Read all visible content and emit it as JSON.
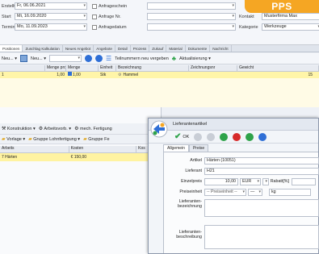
{
  "badge": "PPS",
  "form": {
    "rows": [
      {
        "label": "Erstellt",
        "value": "Fr, 06.06.2021",
        "label2": "Anfrageschein",
        "value2": ""
      },
      {
        "label": "Start",
        "value": "Mi, 16.09.2020",
        "label2": "Anfrage Nr.",
        "value2": "",
        "label3": "Kontakt",
        "value3": "Musterfirma Max"
      },
      {
        "label": "Termin",
        "value": "Mo, 11.09.2023",
        "label2": "Anfragedatum",
        "value2": "",
        "label3": "Kategorie",
        "value3": "Werkzeuge"
      }
    ]
  },
  "tabs": [
    "Positionen",
    "Zuschlag Kalkulation",
    "Neues Angebot",
    "Angebote",
    "Detail",
    "Prozess",
    "Zukauf",
    "Material",
    "Dokumente",
    "Nachricht"
  ],
  "toolbar": {
    "menu_label": "Neu...",
    "item1": "Neu...",
    "action1": "Teilnummern neu vergeben",
    "action2": "Aktualisierung"
  },
  "table1": {
    "headers": [
      "",
      "Menge pro",
      "Menge",
      "Einheit",
      "Bezeichnung",
      "Zeichnungsnr",
      "Gewicht"
    ],
    "rows": [
      [
        "1",
        "1,00",
        "1,00",
        "Stk",
        "Hammel",
        "",
        "15"
      ]
    ]
  },
  "lower": {
    "bar1": [
      "Konstruktion",
      "Arbeitsvorb.",
      "mech. Fertigung"
    ],
    "bar2": [
      "Vorlage",
      "Gruppe Lohnfertigung",
      "Gruppe Fe"
    ],
    "headers": [
      "Arbeits",
      "Kosten",
      "Kos"
    ],
    "rows": [
      [
        "7 Härten",
        "€ 150,00",
        ""
      ]
    ]
  },
  "dialog": {
    "title": "Lieferantenartikel",
    "ok": "OK",
    "tabs": [
      "Allgemein",
      "Preise"
    ],
    "fields": {
      "artikel_label": "Artikel",
      "artikel_value": "Härten (10051)",
      "lieferant_label": "Lieferant",
      "lieferant_value": "H21",
      "einzelpreis_label": "Einzelpreis",
      "einzelpreis_value": "10,00",
      "currency": "EUR",
      "rabatt_label": "Rabatt[%]",
      "preiseinheit_label": "Preiseinheit",
      "preiseinheit_value": "-- Preiseinheit --",
      "preiseinheit_unit": "kg",
      "bez_label1": "Lieferanten-",
      "bez_label2": "bezeichnung",
      "beschr_label1": "Lieferanten-",
      "beschr_label2": "beschreibung"
    }
  },
  "colors": {
    "badge": "#f5a623",
    "highlight": "#fff5a8",
    "ok_green": "#2ea34a",
    "red": "#d62a2a",
    "blue": "#2f6fd6"
  }
}
